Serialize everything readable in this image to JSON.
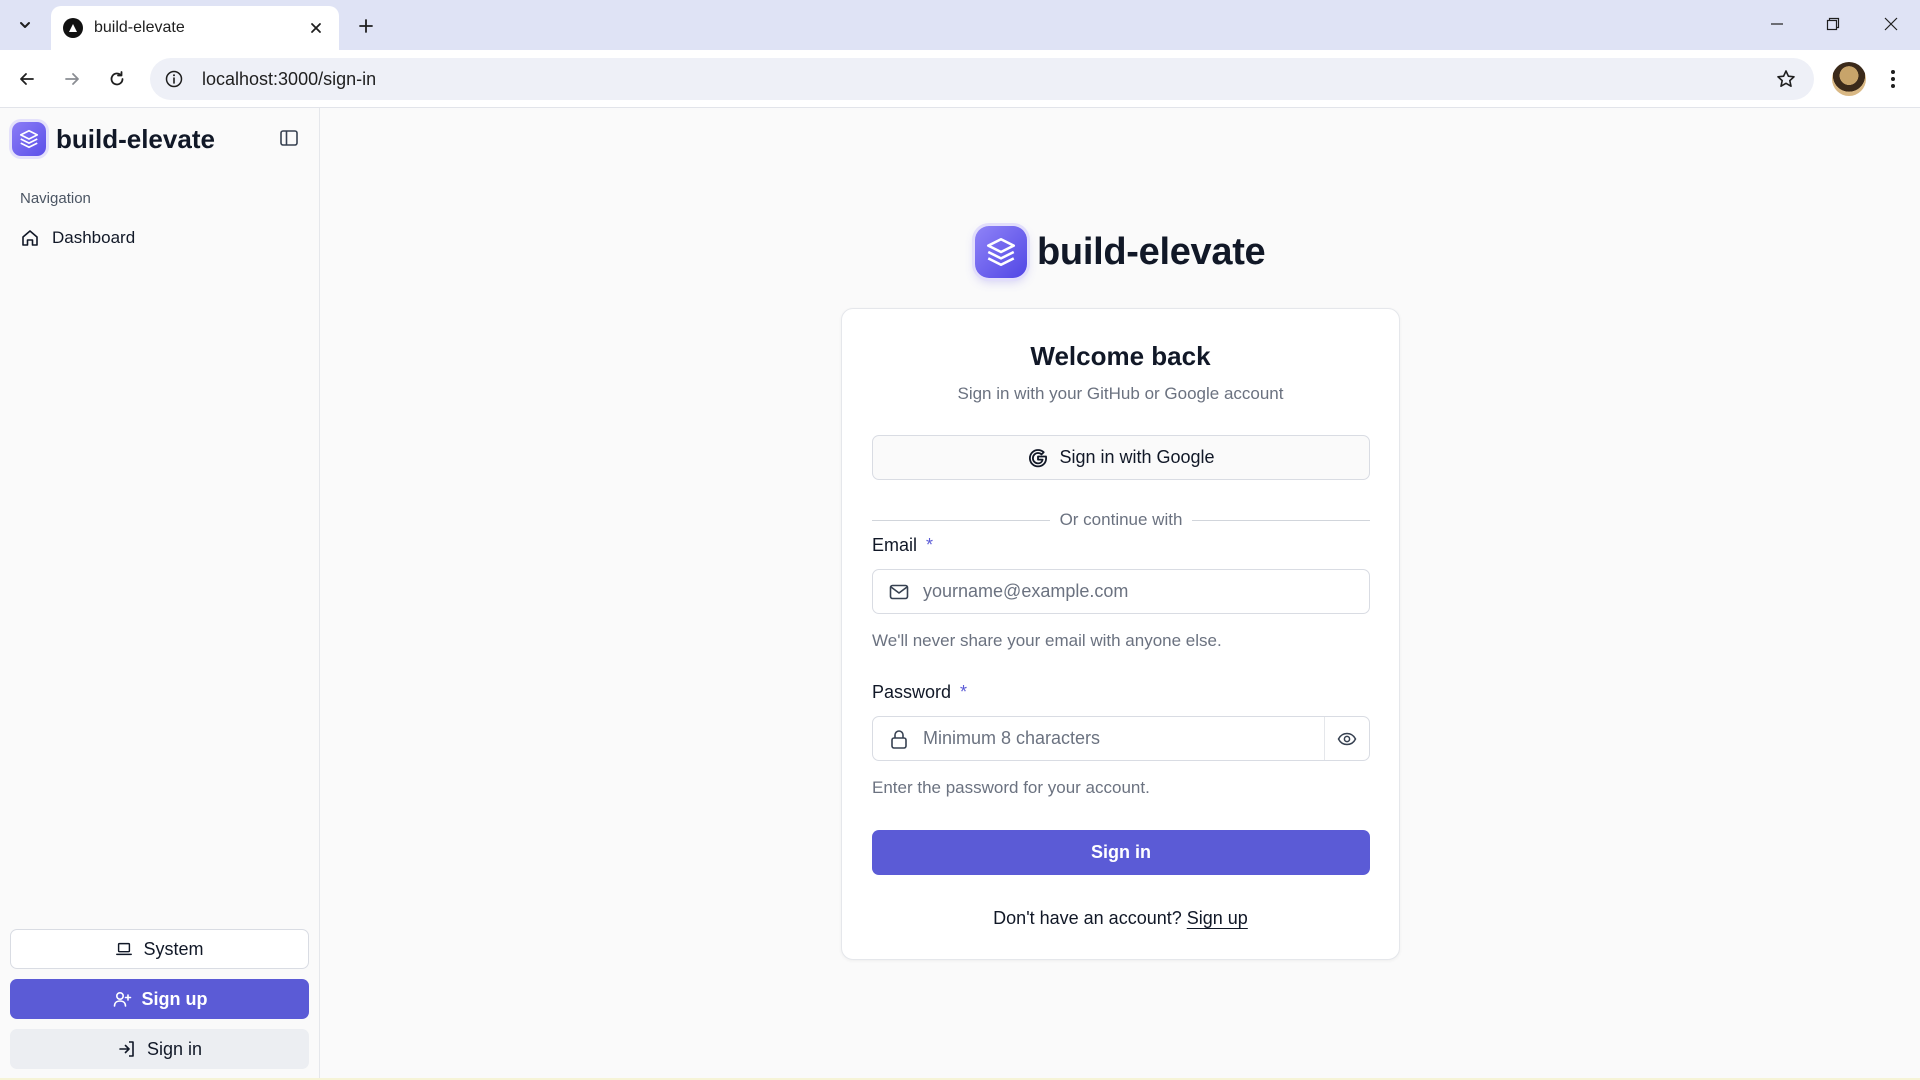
{
  "browser": {
    "tab_title": "build-elevate",
    "url": "localhost:3000/sign-in"
  },
  "sidebar": {
    "brand": "build-elevate",
    "nav_caption": "Navigation",
    "items": [
      {
        "label": "Dashboard",
        "icon": "home-icon"
      }
    ],
    "system_label": "System",
    "signup_label": "Sign up",
    "signin_label": "Sign in"
  },
  "main": {
    "brand": "build-elevate",
    "card": {
      "title": "Welcome back",
      "subtitle": "Sign in with your GitHub or Google account",
      "google_label": "Sign in with Google",
      "divider": "Or continue with",
      "email": {
        "label": "Email",
        "required_mark": "*",
        "placeholder": "yourname@example.com",
        "value": "",
        "hint": "We'll never share your email with anyone else."
      },
      "password": {
        "label": "Password",
        "required_mark": "*",
        "placeholder": "Minimum 8 characters",
        "value": "",
        "hint": "Enter the password for your account."
      },
      "submit_label": "Sign in",
      "footer_text": "Don't have an account?",
      "footer_link": "Sign up"
    }
  },
  "colors": {
    "accent": "#5b5bd6",
    "chrome_tabstrip": "#dfe3f5",
    "page_bg": "#fafafa"
  }
}
